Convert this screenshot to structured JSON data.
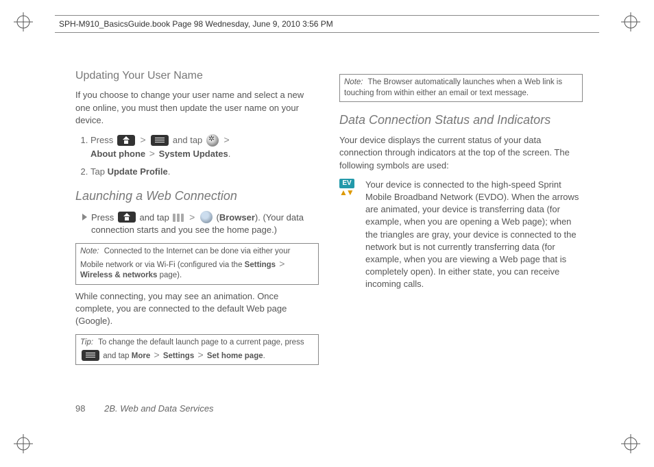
{
  "header": {
    "runhead": "SPH-M910_BasicsGuide.book  Page 98  Wednesday, June 9, 2010  3:56 PM"
  },
  "left": {
    "h_update": "Updating Your User Name",
    "p_update_intro": "If you choose to change your user name and select a new one online, you must then update the user name on your device.",
    "step1_pre": "Press ",
    "step1_mid": " and tap ",
    "step1_path_a": "About phone",
    "step1_path_b": "System Updates",
    "step2_pre": "Tap ",
    "step2_bold": "Update Profile",
    "h_launch": "Launching a Web Connection",
    "launch_pre": "Press ",
    "launch_mid": " and tap ",
    "launch_browser": "Browser",
    "launch_tail": "). (Your data connection starts and you see the home page.)",
    "note1_label": "Note:",
    "note1_a": "Connected to the Internet can be done via either your Mobile network or via Wi-Fi (configured via the ",
    "note1_b": "Settings",
    "note1_c": "Wireless & networks",
    "note1_d": " page).",
    "p_connecting": "While connecting, you may see an animation. Once complete, you are connected to the default Web page (Google).",
    "tip_label": "Tip:",
    "tip_a": "To change the default launch page to a current page, press ",
    "tip_b": " and tap ",
    "tip_more": "More",
    "tip_settings": "Settings",
    "tip_home": "Set home page",
    "tip_end": "."
  },
  "right": {
    "note2_label": "Note:",
    "note2_text": "The Browser automatically launches when a Web link is touching from within either an email or text message.",
    "h_data": "Data Connection Status and Indicators",
    "p_data_intro": "Your device displays the current status of your data connection through indicators at the top of the screen. The following symbols are used:",
    "ev_label": "EV",
    "p_ev": "Your device is connected to the high-speed Sprint Mobile Broadband Network (EVDO). When the arrows are animated, your device is transferring data (for example, when you are opening a Web page); when the triangles are gray, your device is connected to the network but is not currently transferring data (for example, when you are viewing a Web page that is completely open). In either state, you can receive incoming calls."
  },
  "footer": {
    "page_number": "98",
    "section": "2B. Web and Data Services"
  }
}
